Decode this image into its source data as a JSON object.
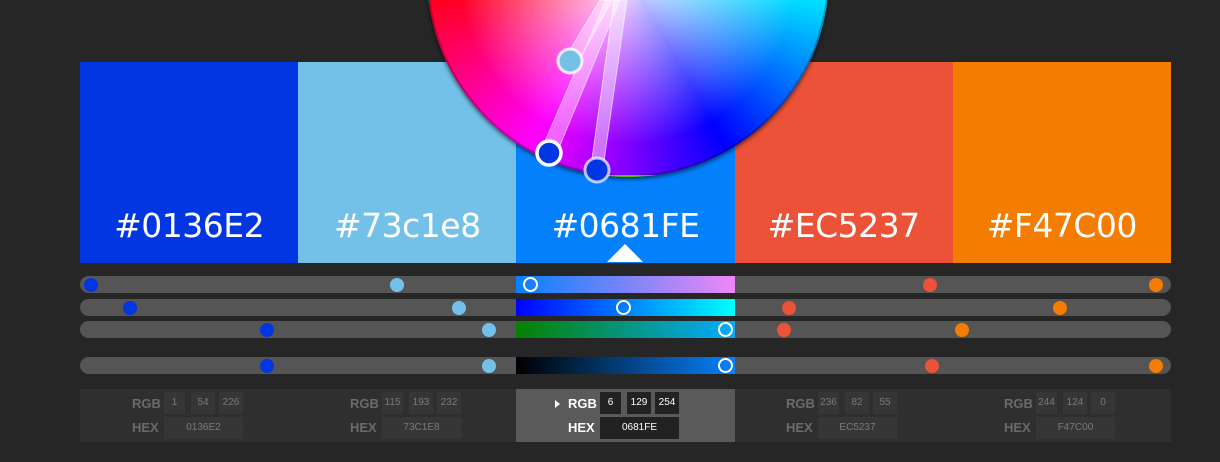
{
  "swatches": [
    {
      "hex": "#0136E2",
      "color": "#0136E2"
    },
    {
      "hex": "#73c1e8",
      "color": "#73c1e8"
    },
    {
      "hex": "#0681FE",
      "color": "#0681FE"
    },
    {
      "hex": "#EC5237",
      "color": "#EC5237"
    },
    {
      "hex": "#F47C00",
      "color": "#F47C00"
    }
  ],
  "selected_index": 2,
  "panel": [
    {
      "rgb_label": "RGB",
      "hex_label": "HEX",
      "r": "1",
      "g": "54",
      "b": "226",
      "hex": "0136E2"
    },
    {
      "rgb_label": "RGB",
      "hex_label": "HEX",
      "r": "115",
      "g": "193",
      "b": "232",
      "hex": "73C1E8"
    },
    {
      "rgb_label": "RGB",
      "hex_label": "HEX",
      "r": "6",
      "g": "129",
      "b": "254",
      "hex": "0681FE"
    },
    {
      "rgb_label": "RGB",
      "hex_label": "HEX",
      "r": "236",
      "g": "82",
      "b": "55",
      "hex": "EC5237"
    },
    {
      "rgb_label": "RGB",
      "hex_label": "HEX",
      "r": "244",
      "g": "124",
      "b": "0",
      "hex": "F47C00"
    }
  ],
  "sliders": [
    {
      "name": "hue",
      "values": [
        0.01,
        0.291,
        0.413,
        0.779,
        0.986
      ]
    },
    {
      "name": "saturation",
      "values": [
        0.046,
        0.347,
        0.498,
        0.65,
        0.898
      ]
    },
    {
      "name": "green",
      "values": [
        0.171,
        0.375,
        0.592,
        0.645,
        0.808
      ]
    },
    {
      "name": "value",
      "values": [
        0.171,
        0.375,
        0.592,
        0.781,
        0.986
      ]
    }
  ],
  "icons": {
    "color_wheel": "color-wheel-icon",
    "expand": "triangle-right-icon"
  }
}
